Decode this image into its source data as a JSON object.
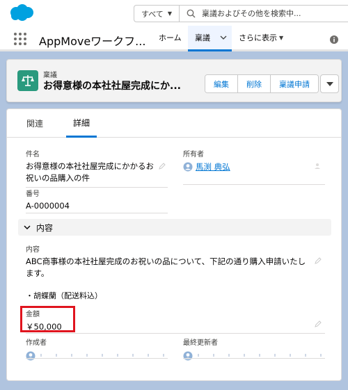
{
  "header": {
    "search_scope": "すべて",
    "search_placeholder": "稟議およびその他を検索中..."
  },
  "nav": {
    "app_name": "AppMoveワークフ...",
    "home": "ホーム",
    "active_tab": "稟議",
    "more": "さらに表示"
  },
  "record": {
    "type": "稟議",
    "title": "お得意様の本社社屋完成にか...",
    "actions": [
      "編集",
      "削除",
      "稟議申請"
    ]
  },
  "tabs": {
    "related": "関連",
    "detail": "詳細"
  },
  "fields": {
    "subject_label": "件名",
    "subject_line1": "お得意様の本社社屋完成にかかるお",
    "subject_line2": "祝いの品購入の件",
    "owner_label": "所有者",
    "owner_value": "馬渕 典弘",
    "number_label": "番号",
    "number_value": "A-0000004",
    "section_title": "内容",
    "content_label": "内容",
    "content_line1": "ABC商事様の本社社屋完成のお祝いの品について、下記の通り購入申請いたし",
    "content_line2": "ます。",
    "content_line3": "・胡蝶蘭（配送料込）",
    "amount_label": "金額",
    "amount_value": "￥50,000",
    "created_by_label": "作成者",
    "modified_by_label": "最終更新者"
  },
  "colors": {
    "brand": "#0176d3",
    "record_icon": "#2a9a7e",
    "highlight": "#e0141e",
    "page_bg": "#b0c4df"
  }
}
